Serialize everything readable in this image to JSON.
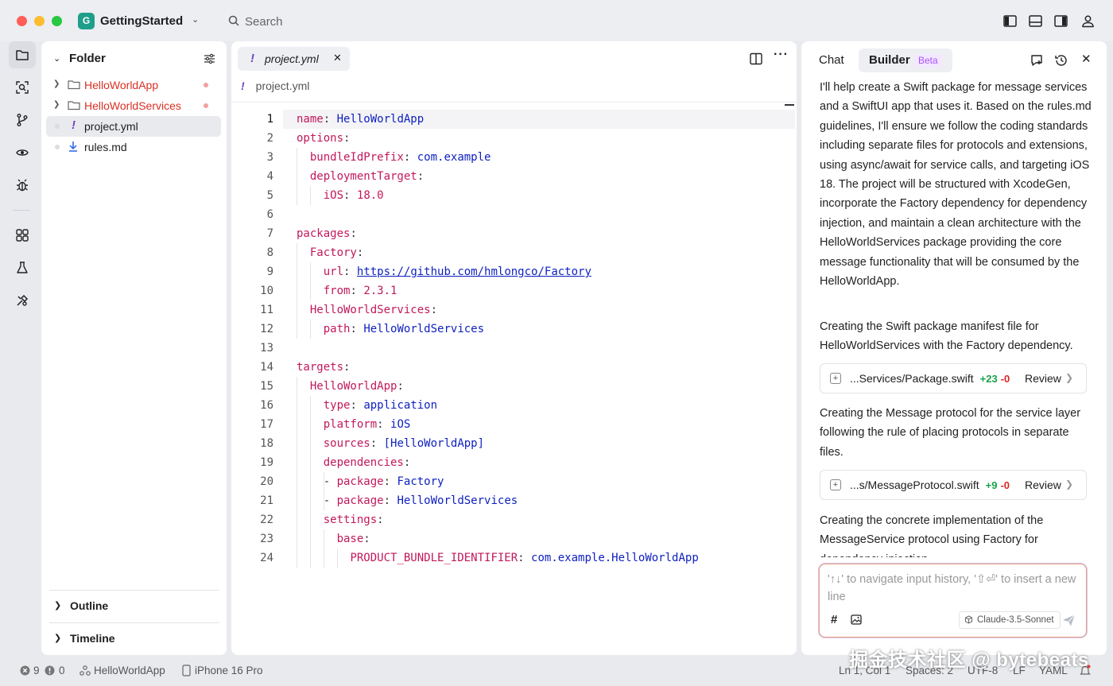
{
  "titlebar": {
    "project_initial": "G",
    "project_name": "GettingStarted",
    "search_label": "Search"
  },
  "explorer": {
    "header": "Folder",
    "items": [
      {
        "label": "HelloWorldApp",
        "type": "folder",
        "status": "error"
      },
      {
        "label": "HelloWorldServices",
        "type": "folder",
        "status": "error"
      },
      {
        "label": "project.yml",
        "type": "yaml",
        "selected": true
      },
      {
        "label": "rules.md",
        "type": "markdown"
      }
    ],
    "sections": [
      "Outline",
      "Timeline"
    ]
  },
  "editor": {
    "tab_label": "project.yml",
    "tab_marker": "!",
    "breadcrumb": "project.yml",
    "lines": [
      {
        "n": "1",
        "key": "name",
        "value": "HelloWorldApp",
        "indent": 0
      },
      {
        "n": "2",
        "key": "options",
        "value": "",
        "indent": 0
      },
      {
        "n": "3",
        "key": "bundleIdPrefix",
        "value": "com.example",
        "indent": 1
      },
      {
        "n": "4",
        "key": "deploymentTarget",
        "value": "",
        "indent": 1
      },
      {
        "n": "5",
        "key": "iOS",
        "value": "18.0",
        "indent": 2,
        "num": true
      },
      {
        "n": "6",
        "key": "",
        "value": "",
        "indent": 0
      },
      {
        "n": "7",
        "key": "packages",
        "value": "",
        "indent": 0
      },
      {
        "n": "8",
        "key": "Factory",
        "value": "",
        "indent": 1
      },
      {
        "n": "9",
        "key": "url",
        "value": "https://github.com/hmlongco/Factory",
        "indent": 2,
        "url": true
      },
      {
        "n": "10",
        "key": "from",
        "value": "2.3.1",
        "indent": 2,
        "num": true
      },
      {
        "n": "11",
        "key": "HelloWorldServices",
        "value": "",
        "indent": 1
      },
      {
        "n": "12",
        "key": "path",
        "value": "HelloWorldServices",
        "indent": 2
      },
      {
        "n": "13",
        "key": "",
        "value": "",
        "indent": 0
      },
      {
        "n": "14",
        "key": "targets",
        "value": "",
        "indent": 0
      },
      {
        "n": "15",
        "key": "HelloWorldApp",
        "value": "",
        "indent": 1
      },
      {
        "n": "16",
        "key": "type",
        "value": "application",
        "indent": 2
      },
      {
        "n": "17",
        "key": "platform",
        "value": "iOS",
        "indent": 2
      },
      {
        "n": "18",
        "key": "sources",
        "value": "[HelloWorldApp]",
        "indent": 2
      },
      {
        "n": "19",
        "key": "dependencies",
        "value": "",
        "indent": 2
      },
      {
        "n": "20",
        "key": "package",
        "value": "Factory",
        "indent": 3,
        "dash": true
      },
      {
        "n": "21",
        "key": "package",
        "value": "HelloWorldServices",
        "indent": 3,
        "dash": true
      },
      {
        "n": "22",
        "key": "settings",
        "value": "",
        "indent": 2
      },
      {
        "n": "23",
        "key": "base",
        "value": "",
        "indent": 3
      },
      {
        "n": "24",
        "key": "PRODUCT_BUNDLE_IDENTIFIER",
        "value": "com.example.HelloWorldApp",
        "indent": 4
      }
    ]
  },
  "chat": {
    "tab_chat": "Chat",
    "tab_builder": "Builder",
    "beta_badge": "Beta",
    "messages": [
      "I'll help create a Swift package for message services and a SwiftUI app that uses it. Based on the rules.md guidelines, I'll ensure we follow the coding standards including separate files for protocols and extensions, using async/await for service calls, and targeting iOS 18. The project will be structured with XcodeGen, incorporate the Factory dependency for dependency injection, and maintain a clean architecture with the HelloWorldServices package providing the core message functionality that will be consumed by the HelloWorldApp.",
      "Creating the Swift package manifest file for HelloWorldServices with the Factory dependency.",
      "Creating the Message protocol for the service layer following the rule of placing protocols in separate files.",
      "Creating the concrete implementation of the MessageService protocol using Factory for dependency injection."
    ],
    "diffs": [
      {
        "file": "...Services/Package.swift",
        "added": "+23",
        "removed": "-0",
        "action": "Review"
      },
      {
        "file": "...s/MessageProtocol.swift",
        "added": "+9",
        "removed": "-0",
        "action": "Review"
      }
    ],
    "input_placeholder": "'↑↓' to navigate input history, '⇧⏎' to insert a new line",
    "hash_label": "#",
    "model": "Claude-3.5-Sonnet"
  },
  "statusbar": {
    "errors": "9",
    "warnings": "0",
    "scheme": "HelloWorldApp",
    "device": "iPhone 16 Pro",
    "cursor": "Ln 1, Col 1",
    "spaces": "Spaces: 2",
    "encoding": "UTF-8",
    "eol": "LF",
    "language": "YAML"
  },
  "watermark": "掘金技术社区 @ bytebeats",
  "colors": {
    "yaml_key": "#c2185b",
    "yaml_value": "#0d1fbf",
    "error_label": "#d93025",
    "accent_teal": "#1f9e8a",
    "diff_added": "#16a34a",
    "diff_removed": "#dc2626"
  }
}
